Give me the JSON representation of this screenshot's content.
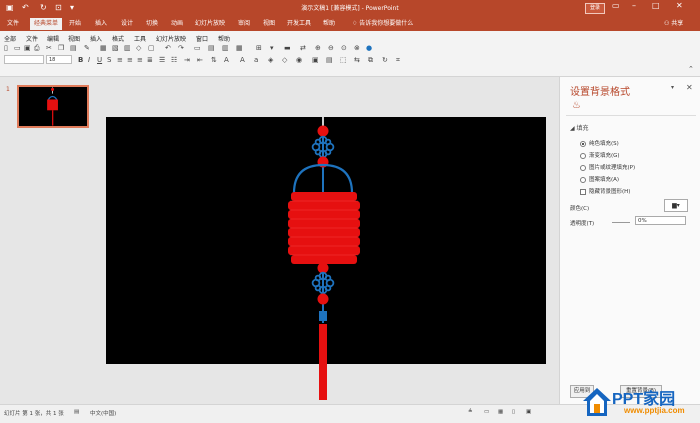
{
  "title_bar": {
    "title": "演示文稿1 [兼容模式] - PowerPoint",
    "sign_in": "登录"
  },
  "tabs": [
    "文件",
    "经典菜单",
    "开始",
    "插入",
    "设计",
    "切换",
    "动画",
    "幻灯片放映",
    "审阅",
    "视图",
    "开发工具",
    "帮助"
  ],
  "active_tab": "经典菜单",
  "tell_me": "告诉我你想要做什么",
  "share": "共享",
  "menu": [
    "全部",
    "文件",
    "编辑",
    "视图",
    "插入",
    "格式",
    "工具",
    "幻灯片放映",
    "窗口",
    "帮助"
  ],
  "font_size": "18",
  "thumbnail": {
    "number": "1"
  },
  "format_pane": {
    "title": "设置背景格式",
    "section": "填充",
    "options": [
      "纯色填充(S)",
      "渐变填充(G)",
      "图片或纹理填充(P)",
      "图案填充(A)"
    ],
    "selected_option": "纯色填充(S)",
    "hide_background": "隐藏背景图形(H)",
    "color_label": "颜色(C)",
    "transparency_label": "透明度(T)",
    "transparency_value": "0%",
    "apply_all": "应用到",
    "reset": "重置背景(B)"
  },
  "status": {
    "slide_info": "幻灯片 第 1 张，共 1 张",
    "language": "中文(中国)"
  },
  "watermark": {
    "title": "PPT家园",
    "subtitle": "www.pptjia.com"
  },
  "colors": {
    "accent": "#b7472a",
    "lantern_red": "#e61010",
    "knot_blue": "#1e73be",
    "slide_bg": "#000000"
  }
}
